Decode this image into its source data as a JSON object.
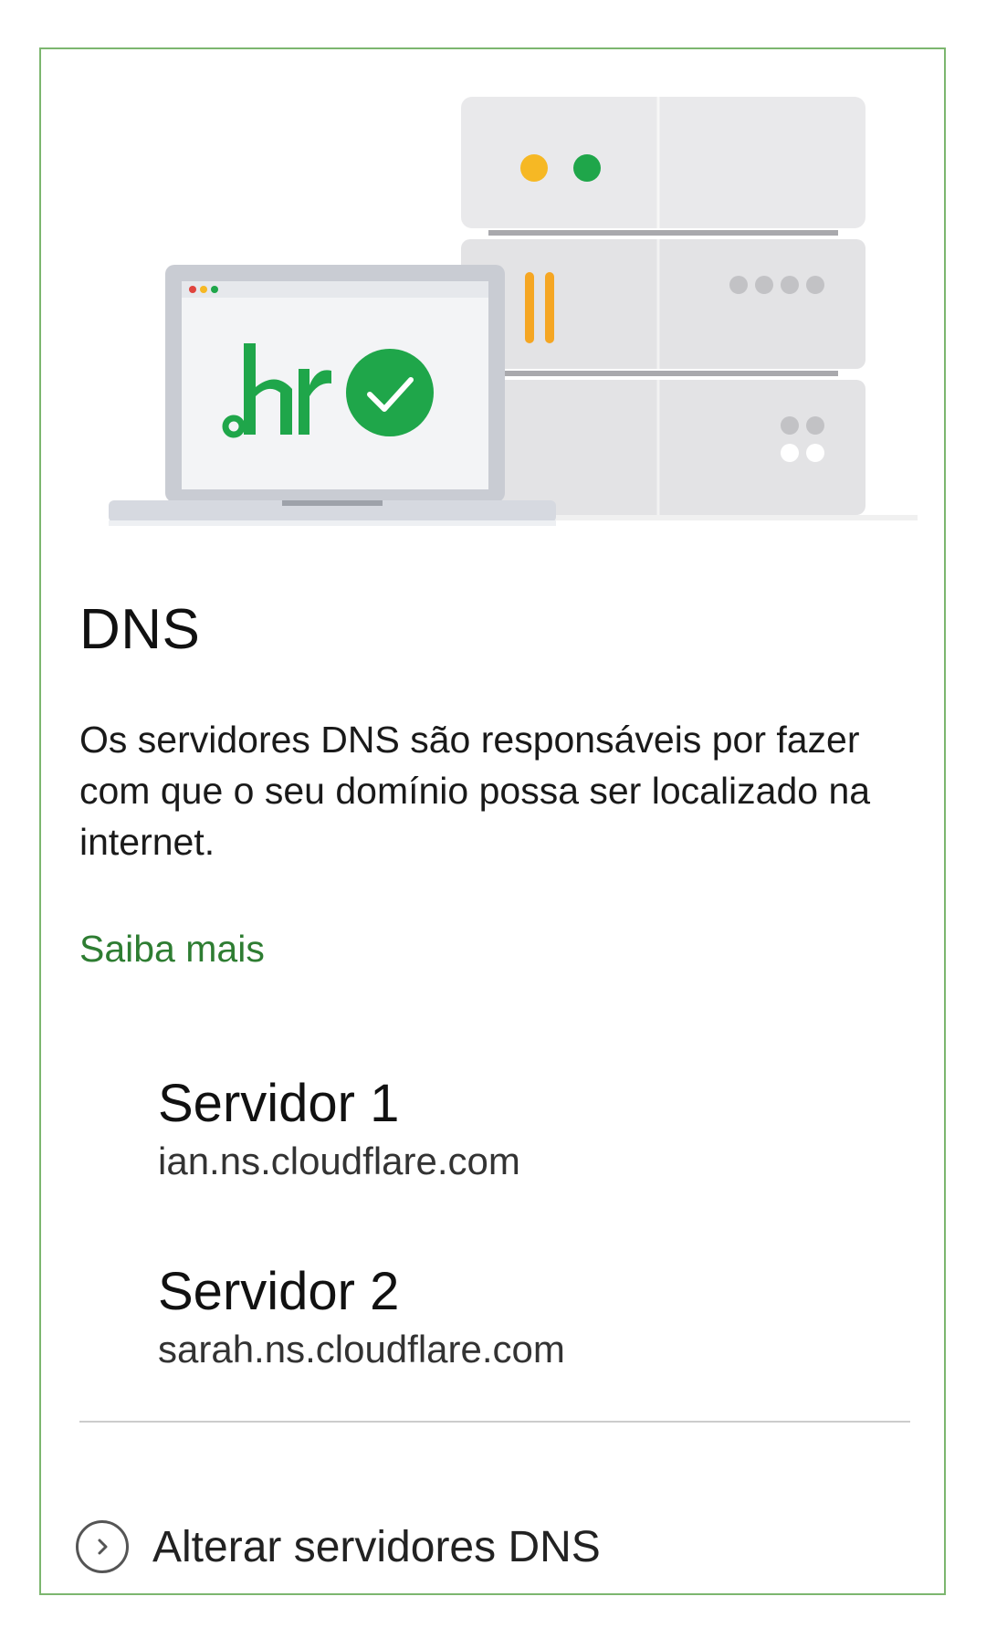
{
  "illustration": {
    "brand_text": ".br",
    "colors": {
      "green": "#1fa64a",
      "yellow": "#f6b824",
      "orange": "#f5a623",
      "server_gray": "#e8e8ea",
      "laptop_frame": "#c9ccd3"
    }
  },
  "card": {
    "title": "DNS",
    "description": "Os servidores DNS são responsáveis por fazer com que o seu domínio possa ser localizado na internet.",
    "learn_more_label": "Saiba mais",
    "accent_color": "#2e7d32",
    "border_color": "#7cb66f"
  },
  "servers": [
    {
      "label": "Servidor 1",
      "value": "ian.ns.cloudflare.com"
    },
    {
      "label": "Servidor 2",
      "value": "sarah.ns.cloudflare.com"
    }
  ],
  "actions": {
    "change_dns_label": "Alterar servidores DNS",
    "change_dns_icon": "chevron-right-circle-icon"
  }
}
